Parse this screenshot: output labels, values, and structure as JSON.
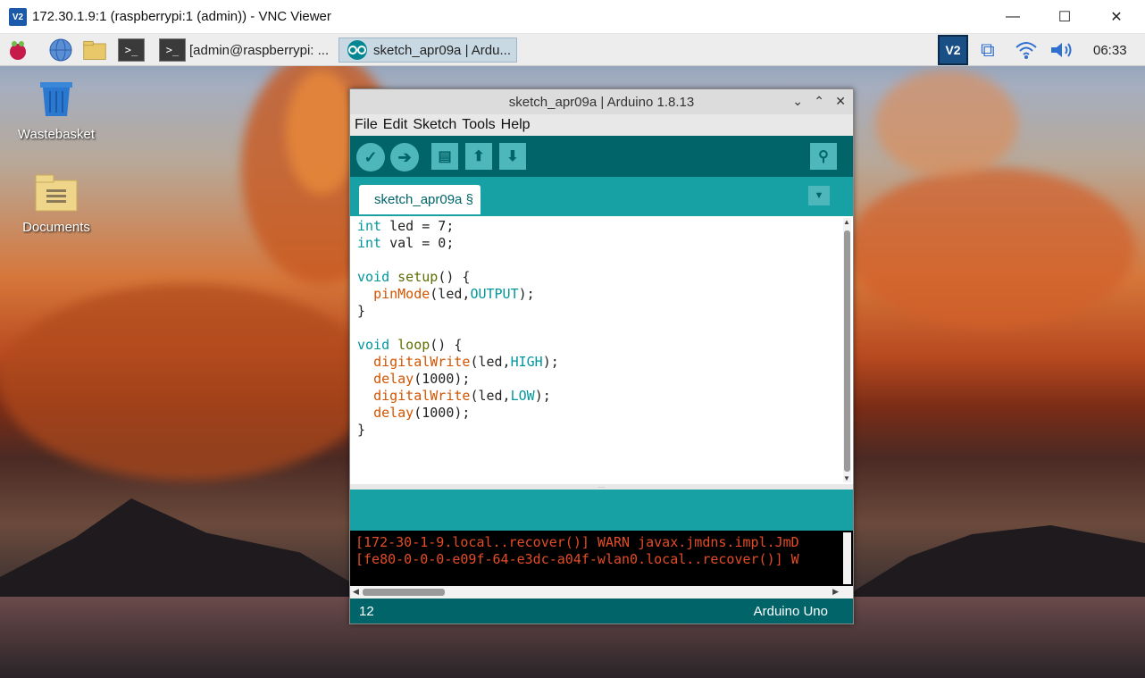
{
  "vnc": {
    "logo": "V2",
    "title": "172.30.1.9:1 (raspberrypi:1 (admin)) - VNC Viewer"
  },
  "taskbar": {
    "terminal_task_label": "[admin@raspberrypi: ...",
    "arduino_task_label": "sketch_apr09a | Ardu...",
    "clock": "06:33",
    "tray_vnc_label": "V2"
  },
  "desktop": {
    "icons": [
      {
        "label": "Wastebasket"
      },
      {
        "label": "Documents"
      }
    ]
  },
  "arduino": {
    "title": "sketch_apr09a | Arduino 1.8.13",
    "menu": [
      "File",
      "Edit",
      "Sketch",
      "Tools",
      "Help"
    ],
    "tab_label": "sketch_apr09a §",
    "code_lines": [
      "int led = 7;",
      "int val = 0;",
      "",
      "void setup() {",
      "  pinMode(led,OUTPUT);",
      "}",
      "",
      "void loop() {",
      "  digitalWrite(led,HIGH);",
      "  delay(1000);",
      "  digitalWrite(led,LOW);",
      "  delay(1000);",
      "}"
    ],
    "console_lines": [
      "[172-30-1-9.local..recover()] WARN javax.jmdns.impl.JmD",
      "[fe80-0-0-0-e09f-64-e3dc-a04f-wlan0.local..recover()] W"
    ],
    "line_number": "12",
    "board": "Arduino Uno"
  }
}
